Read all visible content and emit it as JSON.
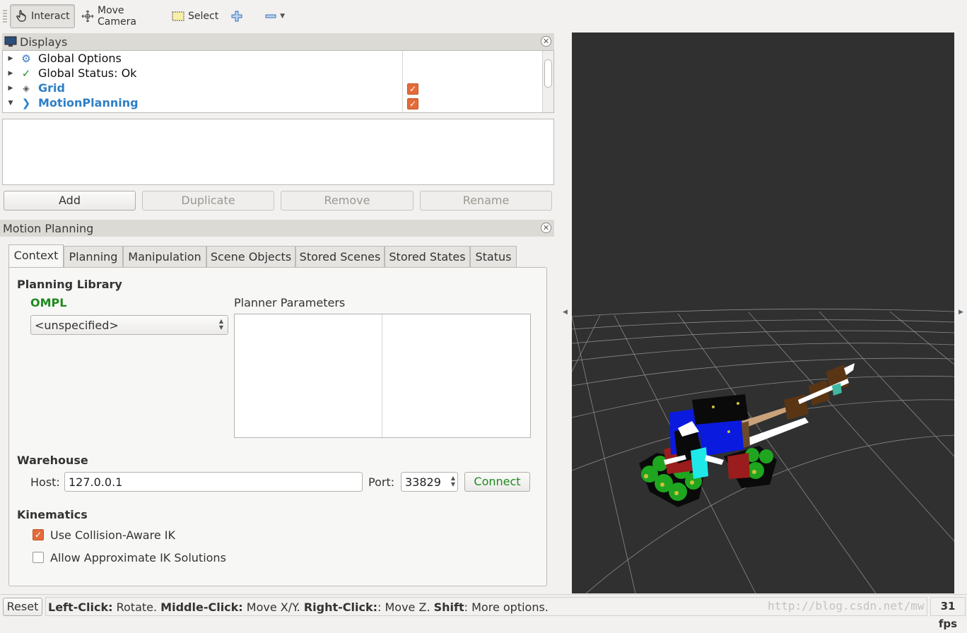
{
  "toolbar": {
    "tools": [
      {
        "label": "Interact",
        "icon": "hand-pointer-icon",
        "active": true
      },
      {
        "label": "Move Camera",
        "icon": "move-arrows-icon",
        "active": false
      },
      {
        "label": "Select",
        "icon": "select-rect-icon",
        "active": false
      }
    ]
  },
  "displays": {
    "title": "Displays",
    "items": [
      {
        "label": "Global Options",
        "icon": "gear-icon",
        "expanded": false,
        "checked": null
      },
      {
        "label": "Global Status: Ok",
        "icon": "checkmark-icon",
        "expanded": false,
        "checked": null
      },
      {
        "label": "Grid",
        "icon": "grid-icon",
        "expanded": false,
        "checked": true
      },
      {
        "label": "MotionPlanning",
        "icon": "motion-planning-icon",
        "expanded": true,
        "checked": true
      }
    ],
    "buttons": {
      "add": "Add",
      "duplicate": "Duplicate",
      "remove": "Remove",
      "rename": "Rename"
    }
  },
  "motion_planning": {
    "title": "Motion Planning",
    "tabs": [
      "Context",
      "Planning",
      "Manipulation",
      "Scene Objects",
      "Stored Scenes",
      "Stored States",
      "Status"
    ],
    "active_tab": "Context",
    "planning_library": {
      "heading": "Planning Library",
      "library": "OMPL",
      "planner_select": "<unspecified>",
      "planner_params_label": "Planner Parameters"
    },
    "warehouse": {
      "heading": "Warehouse",
      "host_label": "Host:",
      "host_value": "127.0.0.1",
      "port_label": "Port:",
      "port_value": "33829",
      "connect_label": "Connect"
    },
    "kinematics": {
      "heading": "Kinematics",
      "collision_aware_ik": {
        "label": "Use Collision-Aware IK",
        "checked": true
      },
      "approximate_ik": {
        "label": "Allow Approximate IK Solutions",
        "checked": false
      }
    }
  },
  "statusbar": {
    "reset_label": "Reset",
    "hint_parts": [
      {
        "text": "Left-Click:",
        "bold": true
      },
      {
        "text": " Rotate. ",
        "bold": false
      },
      {
        "text": "Middle-Click:",
        "bold": true
      },
      {
        "text": " Move X/Y. ",
        "bold": false
      },
      {
        "text": "Right-Click:",
        "bold": true
      },
      {
        "text": ": Move Z. ",
        "bold": false
      },
      {
        "text": "Shift",
        "bold": true
      },
      {
        "text": ": More options.",
        "bold": false
      }
    ],
    "watermark": "http://blog.csdn.net/mw",
    "fps": "31 fps"
  },
  "colors": {
    "accent_check": "#e36c3a",
    "ompl_green": "#1e8a1e",
    "link_blue": "#2d7fc8",
    "viewport_bg": "#303030"
  }
}
